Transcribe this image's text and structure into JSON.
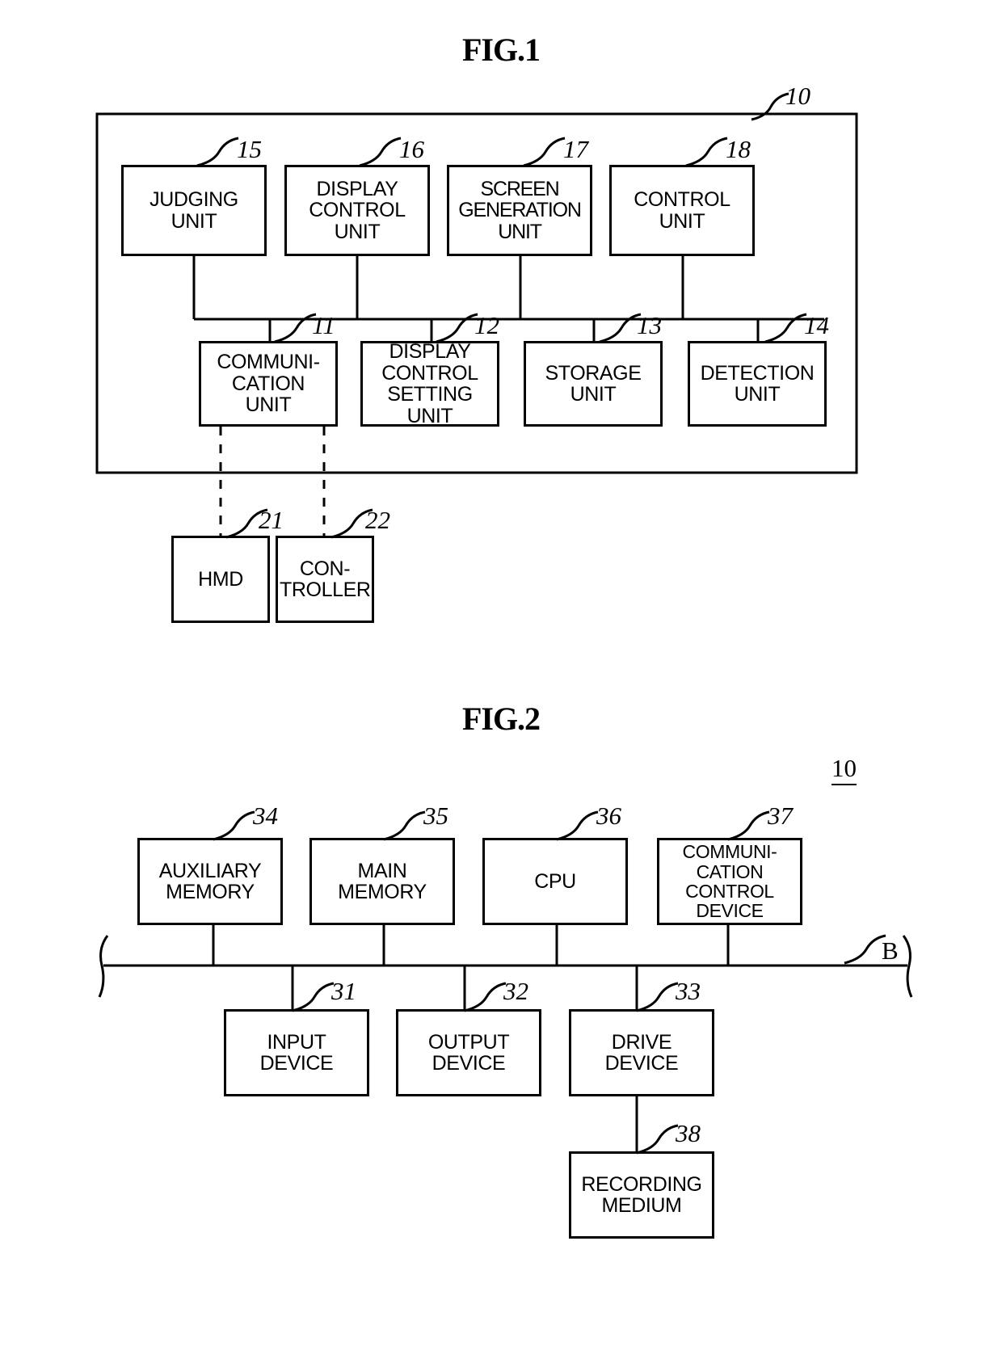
{
  "figures": [
    {
      "id": "fig1",
      "title": "FIG.1",
      "system_ref": "10",
      "boxes": [
        {
          "ref": "15",
          "label": "JUDGING\nUNIT"
        },
        {
          "ref": "16",
          "label": "DISPLAY\nCONTROL\nUNIT"
        },
        {
          "ref": "17",
          "label": "SCREEN\nGENERATION\nUNIT"
        },
        {
          "ref": "18",
          "label": "CONTROL\nUNIT"
        },
        {
          "ref": "11",
          "label": "COMMUNI-\nCATION\nUNIT"
        },
        {
          "ref": "12",
          "label": "DISPLAY\nCONTROL\nSETTING\nUNIT"
        },
        {
          "ref": "13",
          "label": "STORAGE\nUNIT"
        },
        {
          "ref": "14",
          "label": "DETECTION\nUNIT"
        },
        {
          "ref": "21",
          "label": "HMD"
        },
        {
          "ref": "22",
          "label": "CON-\nTROLLER"
        }
      ]
    },
    {
      "id": "fig2",
      "title": "FIG.2",
      "system_ref": "10",
      "bus_ref": "B",
      "boxes": [
        {
          "ref": "34",
          "label": "AUXILIARY\nMEMORY"
        },
        {
          "ref": "35",
          "label": "MAIN\nMEMORY"
        },
        {
          "ref": "36",
          "label": "CPU"
        },
        {
          "ref": "37",
          "label": "COMMUNI-\nCATION\nCONTROL\nDEVICE"
        },
        {
          "ref": "31",
          "label": "INPUT\nDEVICE"
        },
        {
          "ref": "32",
          "label": "OUTPUT\nDEVICE"
        },
        {
          "ref": "33",
          "label": "DRIVE\nDEVICE"
        },
        {
          "ref": "38",
          "label": "RECORDING\nMEDIUM"
        }
      ]
    }
  ]
}
